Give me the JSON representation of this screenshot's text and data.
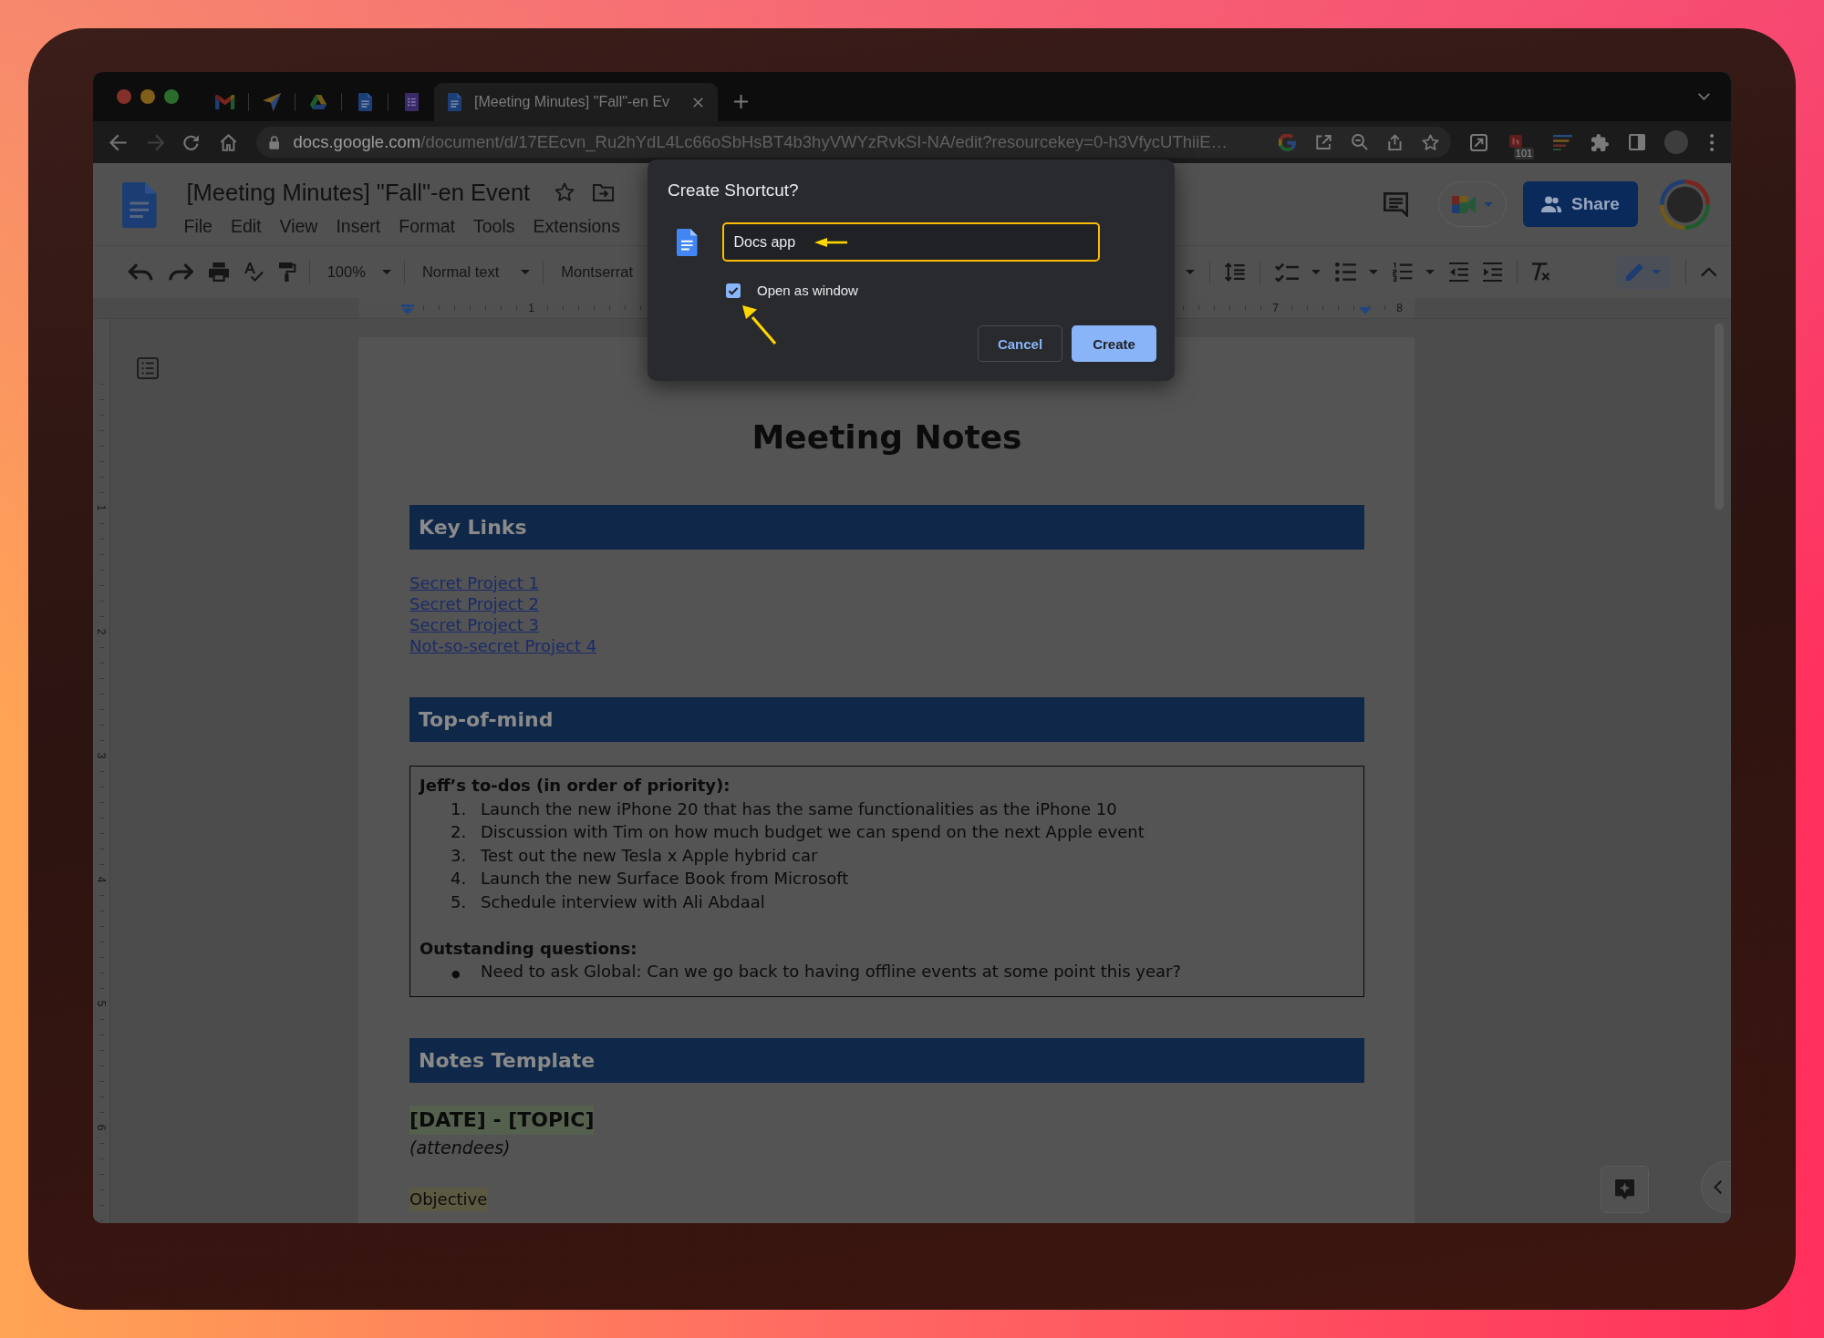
{
  "browser": {
    "tabs": [
      {
        "kind": "mail",
        "selected": false
      },
      {
        "kind": "plane",
        "selected": false
      },
      {
        "kind": "triangle",
        "selected": false
      },
      {
        "kind": "document",
        "selected": false
      },
      {
        "kind": "form",
        "selected": false
      },
      {
        "kind": "document",
        "title": "[Meeting Minutes] \"Fall\"-en Ev",
        "selected": true
      }
    ],
    "address": {
      "host": "docs.google.com",
      "path": "/document/d/17EEcvn_Ru2hYdL4Lc66oSbHsBT4b3hyVWYzRvkSI-NA/edit?resourcekey=0-h3VfycUThiiE…"
    },
    "extension_badge": "101"
  },
  "docs": {
    "title": "[Meeting Minutes] \"Fall\"-en Event",
    "starred": false,
    "menu": [
      "File",
      "Edit",
      "View",
      "Insert",
      "Format",
      "Tools",
      "Extensions"
    ],
    "share_label": "Share",
    "toolbar": {
      "zoom": "100%",
      "style": "Normal text",
      "font": "Montserrat"
    },
    "ruler_numbers": [
      "1",
      "7",
      "8"
    ],
    "vertical_ruler_numbers": [
      "1",
      "2",
      "3",
      "4",
      "5",
      "6"
    ]
  },
  "document": {
    "title": "Meeting Notes",
    "sections": [
      {
        "kind": "heading",
        "text": "Key Links"
      },
      {
        "kind": "links",
        "items": [
          "Secret Project 1",
          "Secret Project 2",
          "Secret Project 3",
          "Not-so-secret Project 4"
        ]
      },
      {
        "kind": "heading",
        "text": "Top-of-mind"
      },
      {
        "kind": "box",
        "blocks": [
          {
            "heading": "Jeff’s to-dos (in order of priority):",
            "kind": "numbered",
            "items": [
              {
                "marker": "1.",
                "text": "Launch the new iPhone 20 that has the same functionalities as the iPhone 10"
              },
              {
                "marker": "2.",
                "text": "Discussion with Tim on how much budget we can spend on the next Apple event"
              },
              {
                "marker": "3.",
                "text": "Test out the new Tesla x Apple hybrid car"
              },
              {
                "marker": "4.",
                "text": "Launch the new Surface Book from Microsoft"
              },
              {
                "marker": "5.",
                "text": "Schedule interview with Ali Abdaal"
              }
            ]
          },
          {
            "heading": "Outstanding questions:",
            "kind": "bulleted",
            "items": [
              {
                "marker": "●",
                "text": "Need to ask Global: Can we go back to having offline events at some point this year?"
              }
            ]
          }
        ]
      },
      {
        "kind": "heading",
        "text": "Notes Template"
      },
      {
        "kind": "subheading",
        "text": "[DATE] - [TOPIC]"
      },
      {
        "kind": "italic_line",
        "text": "(attendees)"
      },
      {
        "kind": "highlight_line",
        "text": "Objective"
      }
    ]
  },
  "dialog": {
    "title": "Create Shortcut?",
    "name_field": {
      "value": "Docs app"
    },
    "checkbox": {
      "label": "Open as window",
      "checked": true
    },
    "buttons": [
      {
        "kind": "secondary",
        "label": "Cancel"
      },
      {
        "kind": "primary",
        "label": "Create"
      }
    ]
  }
}
